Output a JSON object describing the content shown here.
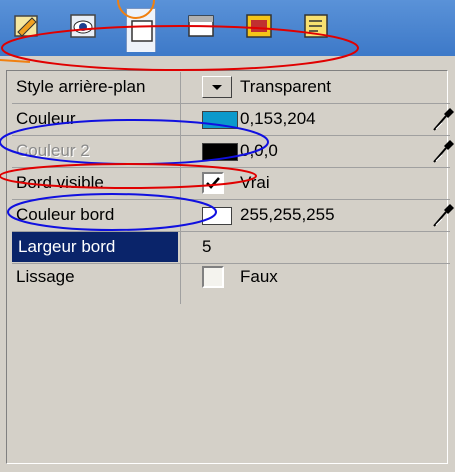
{
  "toolbar": {
    "tabs": [
      {
        "name": "folder-edit-icon"
      },
      {
        "name": "eye-icon"
      },
      {
        "name": "frame-icon"
      },
      {
        "name": "panel-icon"
      },
      {
        "name": "window-icon"
      },
      {
        "name": "note-icon"
      }
    ],
    "active_index": 2
  },
  "properties": [
    {
      "label": "Style arrière-plan",
      "value": "Transparent",
      "control": "dropdown"
    },
    {
      "label": "Couleur",
      "value": "0,153,204",
      "control": "color",
      "color": "#0b99cc",
      "picker": true
    },
    {
      "label": "Couleur 2",
      "value": "0,0,0",
      "control": "color",
      "color": "#000000",
      "picker": true,
      "disabled": true
    },
    {
      "label": "Bord visible",
      "value": "Vrai",
      "control": "checkbox",
      "checked": true
    },
    {
      "label": "Couleur bord",
      "value": "255,255,255",
      "control": "color",
      "color": "#ffffff",
      "picker": true
    },
    {
      "label": "Largeur bord",
      "value": "5",
      "control": "text",
      "selected": true
    },
    {
      "label": "Lissage",
      "value": "Faux",
      "control": "checkbox",
      "checked": false
    }
  ],
  "colors": {
    "toolbar": "#3d79c8",
    "selection": "#0a246a",
    "annotation_red": "#e00000",
    "annotation_blue": "#1010e0",
    "annotation_orange": "#f08010"
  }
}
